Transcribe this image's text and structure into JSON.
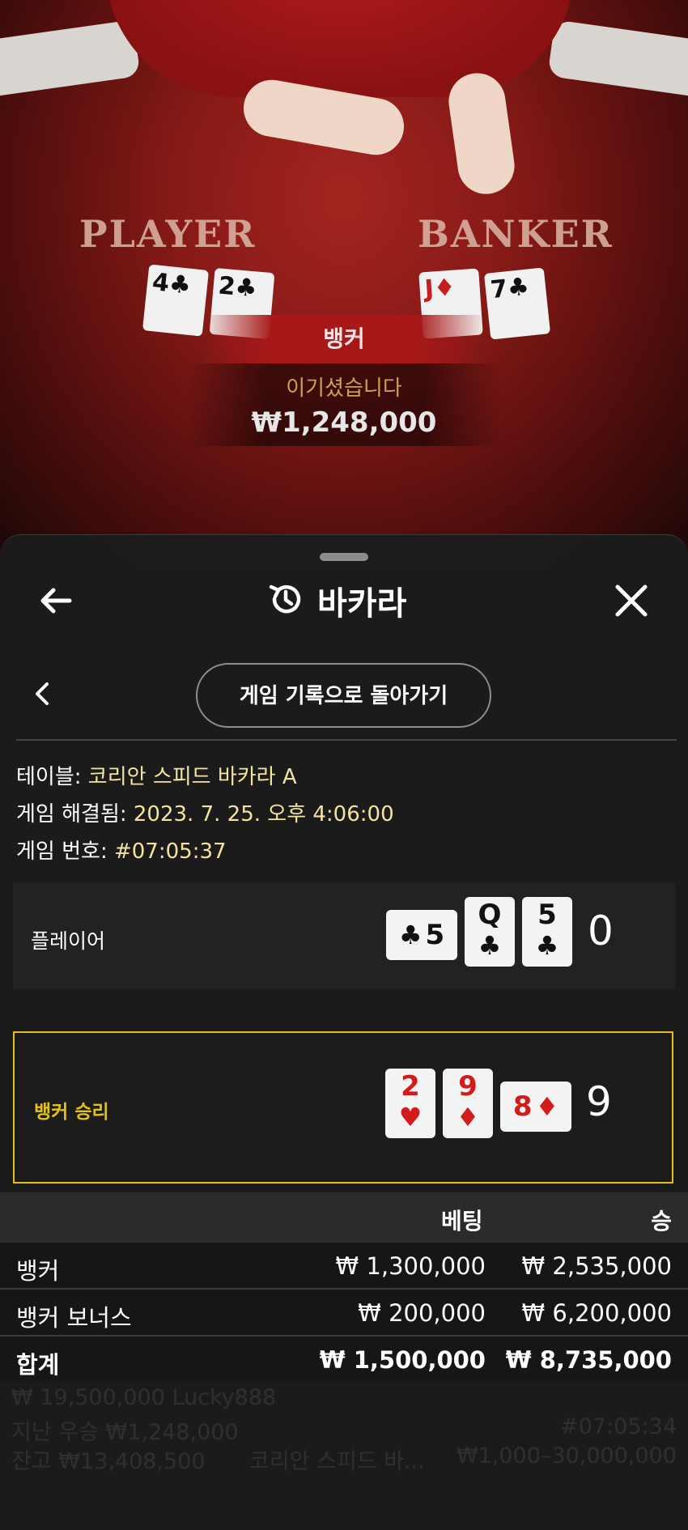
{
  "video": {
    "player_label": "PLAYER",
    "banker_label": "BANKER",
    "player_cards": [
      {
        "rank": "4",
        "suit": "♣",
        "red": false
      },
      {
        "rank": "2",
        "suit": "♣",
        "red": false
      }
    ],
    "banker_cards": [
      {
        "rank": "J",
        "suit": "♦",
        "red": true
      },
      {
        "rank": "7",
        "suit": "♣",
        "red": false
      }
    ],
    "result_label": "뱅커",
    "win_text": "이기셨습니다",
    "win_amount": "₩1,248,000"
  },
  "header": {
    "title": "바카라"
  },
  "nav": {
    "return_button": "게임 기록으로 돌아가기"
  },
  "info": {
    "table_label": "테이블: ",
    "table_value": "코리안 스피드 바카라 A",
    "resolved_label": "게임 해결됨: ",
    "resolved_value": "2023. 7. 25. 오후 4:06:00",
    "number_label": "게임 번호: ",
    "number_value": "#07:05:37"
  },
  "hands": {
    "player": {
      "label": "플레이어",
      "score": "0",
      "cards": [
        {
          "rank": "5",
          "suit": "♣",
          "red": false,
          "orientation": "landscape"
        },
        {
          "rank": "Q",
          "suit": "♣",
          "red": false,
          "orientation": "portrait"
        },
        {
          "rank": "5",
          "suit": "♣",
          "red": false,
          "orientation": "portrait"
        }
      ]
    },
    "banker": {
      "label": "뱅커 승리",
      "score": "9",
      "cards": [
        {
          "rank": "2",
          "suit": "♥",
          "red": true,
          "orientation": "portrait"
        },
        {
          "rank": "9",
          "suit": "♦",
          "red": true,
          "orientation": "portrait"
        },
        {
          "rank": "8",
          "suit": "♦",
          "red": true,
          "orientation": "landscape"
        }
      ]
    }
  },
  "bets": {
    "header_bet": "베팅",
    "header_win": "승",
    "rows": [
      {
        "name": "뱅커",
        "bet": "₩ 1,300,000",
        "win": "₩ 2,535,000"
      },
      {
        "name": "뱅커 보너스",
        "bet": "₩ 200,000",
        "win": "₩ 6,200,000"
      },
      {
        "name": "합계",
        "bet": "₩ 1,500,000",
        "win": "₩ 8,735,000"
      }
    ]
  },
  "background_lobby": {
    "line1": "₩ 19,500,000 Lucky888",
    "line2": "지난 우승 ₩1,248,000",
    "line2_right": "#07:05:34",
    "line3": "잔고 ₩13,408,500",
    "line3_mid": "코리안 스피드 바...",
    "line3_right": "₩1,000–30,000,000"
  },
  "colors": {
    "accent_yellow": "#e2c315",
    "info_value": "#f4e3a0",
    "win_gold": "#c9a34f",
    "table_red": "#8d1a17"
  }
}
